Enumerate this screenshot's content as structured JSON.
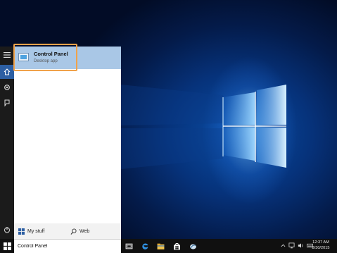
{
  "start_search_result": {
    "title": "Control Panel",
    "subtitle": "Desktop app",
    "icon": "control-panel-icon"
  },
  "filters": {
    "my_stuff_label": "My stuff",
    "web_label": "Web"
  },
  "search": {
    "value": "Control Panel"
  },
  "left_strip": {
    "icons": [
      "hamburger-icon",
      "home-icon",
      "settings-icon",
      "feedback-icon",
      "power-icon"
    ]
  },
  "taskbar": {
    "icons": [
      "start-icon",
      "task-view-icon",
      "edge-icon",
      "file-explorer-icon",
      "store-icon",
      "app-icon"
    ]
  },
  "clock": {
    "time": "12:37 AM",
    "date": "8/30/2015"
  },
  "colors": {
    "accent": "#2d5fa3",
    "highlight_border": "#f0a24a",
    "selected_result": "#a9c7e6"
  }
}
